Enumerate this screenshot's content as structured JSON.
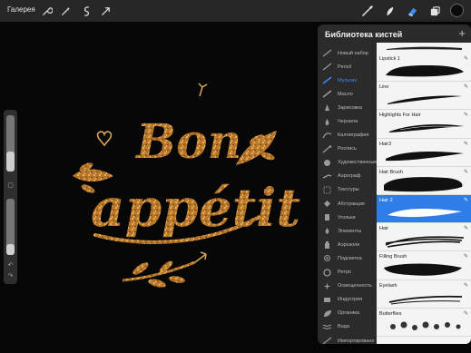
{
  "topbar": {
    "gallery_label": "Галерея",
    "tools": [
      "wrench-icon",
      "magic-wand-icon",
      "selection-icon",
      "move-icon"
    ],
    "right_tools": [
      "brush-icon",
      "smudge-icon",
      "eraser-icon",
      "layers-icon"
    ],
    "active_tool": "eraser-icon",
    "color": "#0b0b0b"
  },
  "artwork": {
    "line1": "Bon",
    "line2": "appétit",
    "accent_color": "#c9862f"
  },
  "sidebar": {
    "brush_size": 0.35,
    "opacity": 0.2
  },
  "library": {
    "title": "Библиотека кистей",
    "add_label": "+",
    "sets": [
      {
        "label": "Новый набор"
      },
      {
        "label": "Pencil"
      },
      {
        "label": "Мультик",
        "active": true
      },
      {
        "label": "Масло"
      },
      {
        "label": "Зарисовка"
      },
      {
        "label": "Чернила"
      },
      {
        "label": "Каллиграфия"
      },
      {
        "label": "Роспись"
      },
      {
        "label": "Художественные"
      },
      {
        "label": "Аэрограф"
      },
      {
        "label": "Текстуры"
      },
      {
        "label": "Абстракция"
      },
      {
        "label": "Угольки"
      },
      {
        "label": "Элементы"
      },
      {
        "label": "Аэрозоли"
      },
      {
        "label": "Подсветка"
      },
      {
        "label": "Ретро"
      },
      {
        "label": "Освещенность"
      },
      {
        "label": "Индустрия"
      },
      {
        "label": "Органика"
      },
      {
        "label": "Вода"
      },
      {
        "label": "Импортировано"
      }
    ],
    "brushes": [
      {
        "name": "Lipstick 1"
      },
      {
        "name": "Line"
      },
      {
        "name": "Highlights For Hair"
      },
      {
        "name": "Hair3"
      },
      {
        "name": "Hair Brush"
      },
      {
        "name": "Hair 2",
        "selected": true
      },
      {
        "name": "Hair"
      },
      {
        "name": "Filling Brush"
      },
      {
        "name": "Eyelash"
      },
      {
        "name": "Butterflies"
      }
    ]
  }
}
